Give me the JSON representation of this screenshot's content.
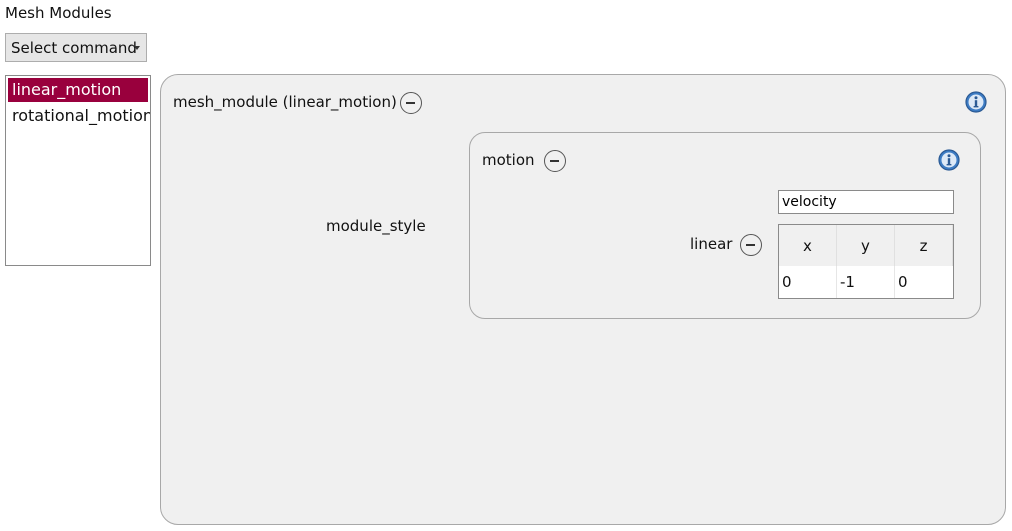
{
  "title": "Mesh Modules",
  "command_button": {
    "label": "Select command"
  },
  "module_list": {
    "items": [
      {
        "label": "linear_motion",
        "selected": true
      },
      {
        "label": "rotational_motion",
        "selected": false
      }
    ]
  },
  "panel": {
    "title": "mesh_module (linear_motion)",
    "module_style_label": "module_style",
    "motion": {
      "title": "motion",
      "velocity_value": "velocity",
      "linear_label": "linear",
      "vector": {
        "headers": [
          "x",
          "y",
          "z"
        ],
        "values": [
          "0",
          "-1",
          "0"
        ]
      }
    }
  },
  "colors": {
    "selection": "#99003d",
    "panel_bg": "#f0f0f0",
    "info_icon": "#3d7cc4"
  },
  "icons": {
    "collapse": "minus-circle-icon",
    "info": "info-icon",
    "dropdown": "chevron-down-icon"
  }
}
